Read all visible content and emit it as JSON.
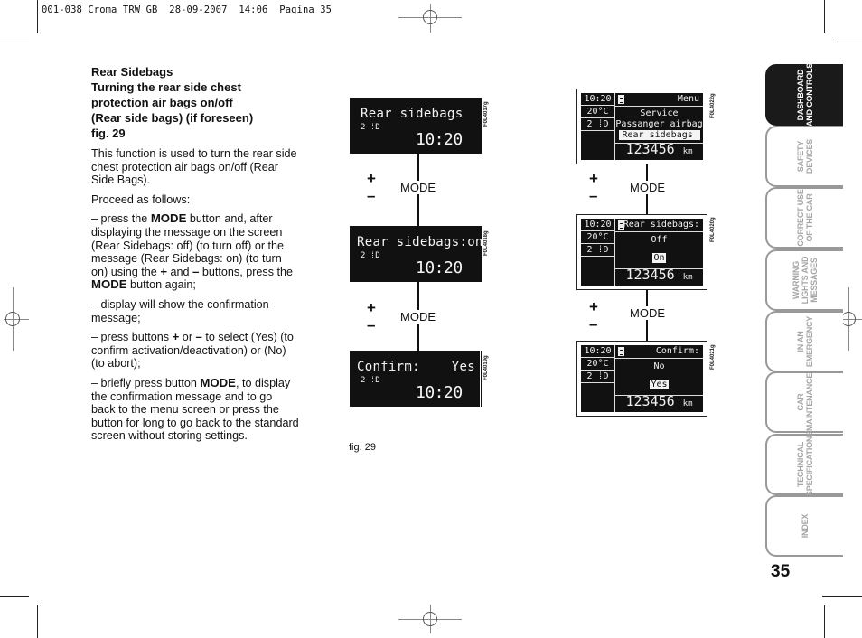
{
  "print_header": "001-038 Croma TRW GB  28-09-2007  14:06  Pagina 35",
  "section": {
    "heading_lines": [
      "Rear Sidebags",
      "Turning the rear side chest",
      "protection air bags on/off",
      "(Rear side bags) (if foreseen)",
      "fig. 29"
    ],
    "intro": "This function is used to turn the rear side chest protection air bags on/off (Rear Side Bags).",
    "proceed": "Proceed as follows:",
    "steps": [
      {
        "parts": [
          "– press the ",
          "MODE",
          " button and, after displaying the message on the screen (Rear Sidebags: off) (to turn off) or the message (Rear Sidebags: on) (to turn on) using the ",
          "+",
          " and ",
          "–",
          " buttons, press the ",
          "MODE",
          " button again;"
        ]
      },
      {
        "parts": [
          "– display will show the confirmation message;"
        ]
      },
      {
        "parts": [
          "– press buttons ",
          "+",
          " or ",
          "–",
          " to select (Yes) (to confirm activation/deactivation) or (No) (to abort);"
        ]
      },
      {
        "parts": [
          "– briefly press button ",
          "MODE",
          ", to display the confirmation message and to go back to the menu screen or press the button for long to go back to the standard screen without storing settings."
        ]
      }
    ]
  },
  "figure": {
    "label": "fig. 29",
    "controls": {
      "plus": "+",
      "minus": "–",
      "mode": "MODE"
    },
    "small_displays": [
      {
        "code": "F0L4017g",
        "message": "Rear sidebags",
        "sub": "2 ⁞D",
        "time": "10:20"
      },
      {
        "code": "F0L4018g",
        "message": "Rear sidebags:on",
        "sub": "2 ⁞D",
        "time": "10:20"
      },
      {
        "code": "F0L4019g",
        "message": "Confirm:    Yes",
        "sub": "2 ⁞D",
        "time": "10:20"
      }
    ],
    "multifunction_displays": [
      {
        "code": "F0L4022g",
        "clock": "10:20",
        "temp": "20°C",
        "gear": "2 ⁞D",
        "title": "Menu",
        "lines": [
          "Service",
          "Passanger airbag",
          "Rear  sidebags"
        ],
        "highlighted_index": 2,
        "odometer": "123456",
        "odometer_unit": "km"
      },
      {
        "code": "F0L4020g",
        "clock": "10:20",
        "temp": "20°C",
        "gear": "2 ⁞D",
        "title": "Rear sidebags:",
        "lines": [
          "Off",
          "On"
        ],
        "highlighted_index": 1,
        "odometer": "123456",
        "odometer_unit": "km"
      },
      {
        "code": "F0L4021g",
        "clock": "10:20",
        "temp": "20°C",
        "gear": "2 ⁞D",
        "title": "Confirm:",
        "lines": [
          "No",
          "Yes"
        ],
        "highlighted_index": 1,
        "odometer": "123456",
        "odometer_unit": "km"
      }
    ]
  },
  "side_tabs": [
    {
      "label": "DASHBOARD\nAND CONTROLS",
      "active": true
    },
    {
      "label": "SAFETY\nDEVICES",
      "active": false
    },
    {
      "label": "CORRECT USE\nOF THE CAR",
      "active": false
    },
    {
      "label": "WARNING\nLIGHTS AND\nMESSAGES",
      "active": false
    },
    {
      "label": "IN AN\nEMERGENCY",
      "active": false
    },
    {
      "label": "CAR\nMAINTENANCE",
      "active": false
    },
    {
      "label": "TECHNICAL\nSPECIFICATIONS",
      "active": false
    },
    {
      "label": "INDEX",
      "active": false
    }
  ],
  "page_number": "35"
}
